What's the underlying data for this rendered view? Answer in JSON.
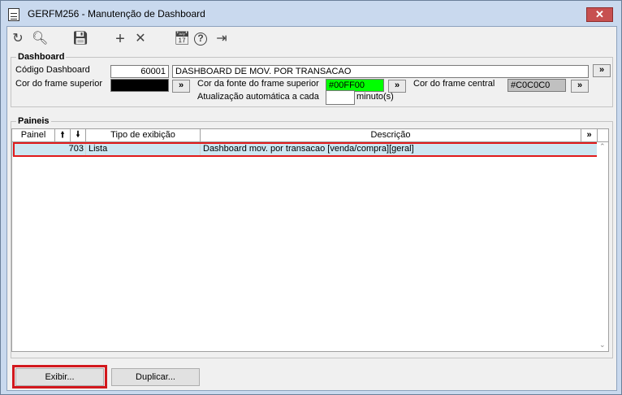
{
  "window": {
    "title": "GERFM256 - Manutenção de Dashboard",
    "close_glyph": "✕"
  },
  "toolbar": {
    "icons": [
      {
        "name": "refresh-icon",
        "glyph": "↻"
      },
      {
        "name": "search-icon",
        "glyph": "🔍︎"
      },
      {
        "name": "save-icon",
        "glyph": "💾︎"
      },
      {
        "name": "add-icon",
        "glyph": "+"
      },
      {
        "name": "delete-icon",
        "glyph": "✕"
      },
      {
        "name": "calendar-icon",
        "glyph": "📅︎"
      },
      {
        "name": "help-icon",
        "glyph": "?"
      },
      {
        "name": "exit-icon",
        "glyph": "⇥"
      }
    ]
  },
  "dashboard": {
    "group_title": "Dashboard",
    "codigo_label": "Código Dashboard",
    "codigo_value": "60001",
    "descricao_value": "DASHBOARD DE MOV. POR TRANSACAO",
    "cor_frame_superior_label": "Cor do frame superior",
    "cor_frame_superior_value": "",
    "cor_frame_superior_color": "#000000",
    "cor_fonte_label": "Cor da fonte do frame superior",
    "cor_fonte_value": "#00FF00",
    "cor_fonte_color": "#00FF00",
    "cor_frame_central_label": "Cor do frame central",
    "cor_frame_central_value": "#C0C0C0",
    "cor_frame_central_color": "#C0C0C0",
    "atualizacao_label": "Atualização automática a cada",
    "atualizacao_value": "",
    "atualizacao_unit": "minuto(s)",
    "more_label": "»"
  },
  "paineis": {
    "group_title": "Paineis",
    "columns": [
      "Painel",
      "🠙",
      "🠛",
      "Tipo de exibição",
      "Descrição",
      "»"
    ],
    "rows": [
      {
        "painel": "703",
        "tipo": "Lista",
        "descricao": "Dashboard mov. por transacao [venda/compra][geral]"
      }
    ],
    "scroll_up": "⌃",
    "scroll_down": "⌄"
  },
  "buttons": {
    "exibir": "Exibir...",
    "duplicar": "Duplicar..."
  }
}
